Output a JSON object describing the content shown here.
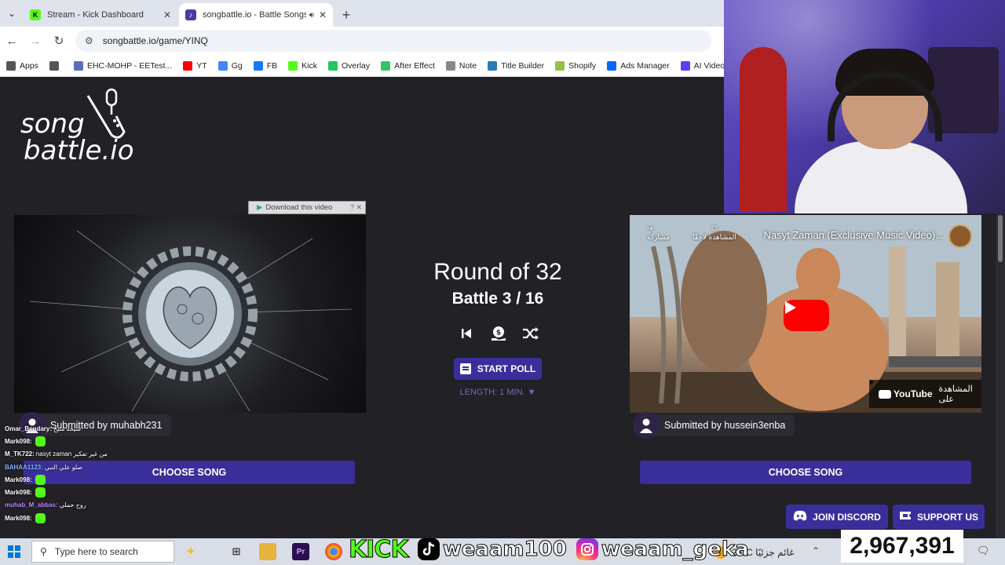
{
  "browser": {
    "tabs": [
      {
        "label": "Stream - Kick Dashboard",
        "favicon": "K",
        "favicon_color": "#53fc18",
        "active": false
      },
      {
        "label": "songbattle.io - Battle Songs",
        "favicon": "♪",
        "favicon_color": "#4b3aa8",
        "active": true
      }
    ],
    "url": "songbattle.io/game/YINQ",
    "bookmarks": [
      {
        "label": "Apps",
        "icon": "apps-grid-icon",
        "color": "#555"
      },
      {
        "label": "",
        "icon": "grid-icon",
        "color": "#555"
      },
      {
        "label": "EHC-MOHP - EETest...",
        "icon": "globe-icon",
        "color": "#5a6fbf"
      },
      {
        "label": "YT",
        "icon": "youtube-icon",
        "color": "#ff0000"
      },
      {
        "label": "Gg",
        "icon": "google-icon",
        "color": "#4285f4"
      },
      {
        "label": "FB",
        "icon": "facebook-icon",
        "color": "#1877f2"
      },
      {
        "label": "Kick",
        "icon": "kick-icon",
        "color": "#53fc18"
      },
      {
        "label": "Overlay",
        "icon": "overlay-icon",
        "color": "#22c55e"
      },
      {
        "label": "After Effect",
        "icon": "fx-icon",
        "color": "#36c26b"
      },
      {
        "label": "Note",
        "icon": "note-icon",
        "color": "#888"
      },
      {
        "label": "Title Builder",
        "icon": "title-builder-icon",
        "color": "#2a7ab5"
      },
      {
        "label": "Shopify",
        "icon": "shopify-icon",
        "color": "#95bf47"
      },
      {
        "label": "Ads Manager",
        "icon": "meta-icon",
        "color": "#0866ff"
      },
      {
        "label": "AI Video",
        "icon": "ai-video-icon",
        "color": "#5b3df5"
      }
    ]
  },
  "page": {
    "logo": {
      "line1": "song",
      "line2": "battle.io"
    },
    "download_bar": "Download this video",
    "round": "Round of 32",
    "battle": "Battle 3 / 16",
    "start_poll": "START POLL",
    "length": "LENGTH: 1 MIN. ▼",
    "left": {
      "submitted": "Submitted by muhabh231",
      "choose": "CHOOSE SONG"
    },
    "right": {
      "yt_title": "Nasyt Zaman (Exclusive Music Video)...",
      "yt_share": "مشاركة",
      "yt_watch_later": "المشاهدة لاحقًا",
      "yt_watch_on": "المشاهدة على",
      "yt_brand": "YouTube",
      "submitted": "Submitted by hussein3enba",
      "choose": "CHOOSE SONG"
    },
    "join_discord": "JOIN DISCORD",
    "support_us": "SUPPORT US"
  },
  "chat": [
    {
      "user": "Omar_Bendary:",
      "msg": "شيخه منيح",
      "color": "#ffffff",
      "emote": false
    },
    {
      "user": "Mark098:",
      "msg": "",
      "color": "#ffffff",
      "emote": true
    },
    {
      "user": "M_TK722:",
      "msg": "nasyt zaman من غير تفكير",
      "color": "#ffffff",
      "emote": false
    },
    {
      "user": "BAHAA1123:",
      "msg": "صلو علي النبي",
      "color": "#7db7ff",
      "emote": false
    },
    {
      "user": "Mark098:",
      "msg": "",
      "color": "#ffffff",
      "emote": true
    },
    {
      "user": "Mark098:",
      "msg": "",
      "color": "#ffffff",
      "emote": true
    },
    {
      "user": "muhab_M_abbas:",
      "msg": "روح حملي",
      "color": "#c084fc",
      "emote": false
    },
    {
      "user": "Mark098:",
      "msg": "",
      "color": "#ffffff",
      "emote": true
    }
  ],
  "taskbar": {
    "search_placeholder": "Type here to search",
    "weather": "23°C  غائم جزئيًا"
  },
  "overlay": {
    "kick": "KICK",
    "tiktok": "weaam100",
    "instagram": "weaam_geka",
    "counter": "2,967,391"
  }
}
